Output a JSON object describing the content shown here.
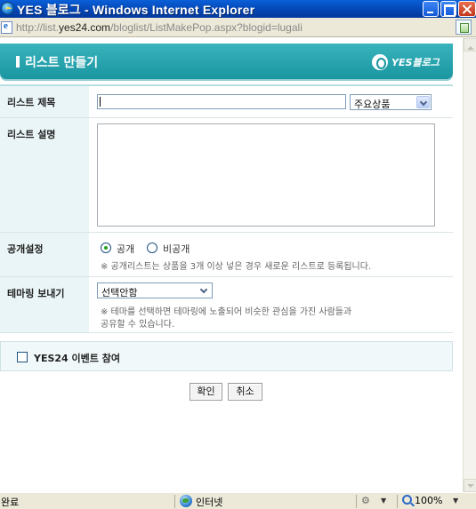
{
  "window": {
    "title": "YES 블로그 - Windows Internet Explorer",
    "url_prefix": "http://list.",
    "url_domain": "yes24.com",
    "url_path": "/bloglist/ListMakePop.aspx?blogid=lugali"
  },
  "header": {
    "title": "리스트 만들기",
    "logo_text": "YES블로그"
  },
  "form": {
    "title_label": "리스트 제목",
    "title_value": "",
    "category_selected": "주요상품",
    "description_label": "리스트 설명",
    "description_value": "",
    "visibility_label": "공개설정",
    "visibility_options": [
      {
        "label": "공개",
        "selected": true
      },
      {
        "label": "비공개",
        "selected": false
      }
    ],
    "visibility_note": "※ 공개리스트는 상품을 3개 이상 넣은 경우 새로운 리스트로 등록됩니다.",
    "theme_label": "테마링 보내기",
    "theme_selected": "선택안함",
    "theme_note_line1": "※ 테마를 선택하면 테마링에 노출되어 비슷한 관심을 가진 사람들과",
    "theme_note_line2": "공유할 수 있습니다.",
    "event_label": "YES24 이벤트 참여",
    "event_checked": false
  },
  "buttons": {
    "confirm": "확인",
    "cancel": "취소"
  },
  "statusbar": {
    "status_text": "완료",
    "zone_text": "인터넷",
    "zoom_text": "100%"
  },
  "colors": {
    "header_teal": "#1a96a1",
    "label_bg": "#eaf5f7",
    "titlebar_blue": "#0447b5"
  }
}
